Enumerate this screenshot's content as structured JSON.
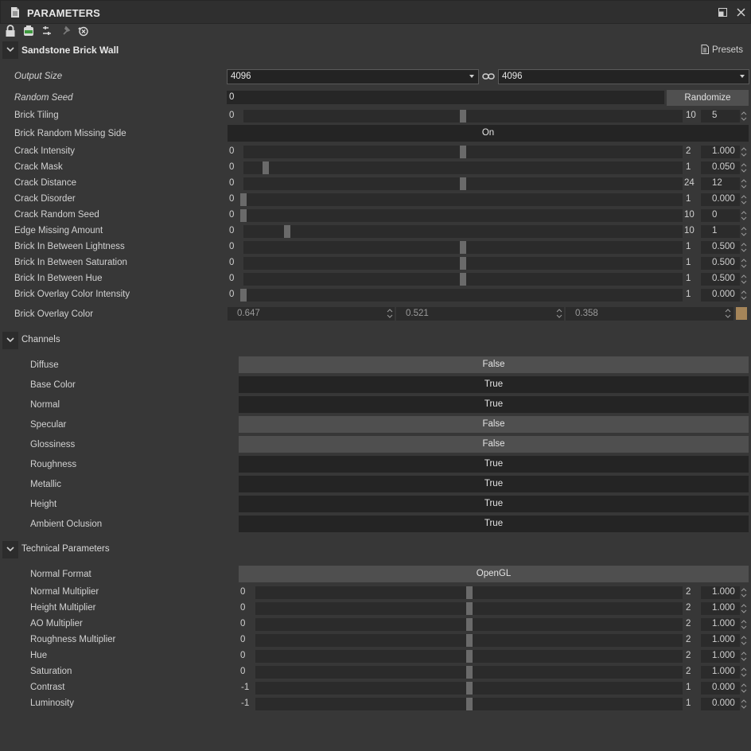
{
  "window": {
    "title": "PARAMETERS"
  },
  "toolbar": {
    "icons": [
      "lock-icon",
      "visibility-icon",
      "connect-icon",
      "pin-icon",
      "reset-icon"
    ]
  },
  "graph": {
    "title": "Sandstone Brick Wall",
    "presets_label": "Presets",
    "output_size": {
      "label": "Output Size",
      "width": "4096",
      "height": "4096"
    },
    "random_seed": {
      "label": "Random Seed",
      "value": "0",
      "button": "Randomize"
    },
    "brick_tiling": {
      "label": "Brick Tiling",
      "min": "0",
      "max": "10",
      "value": "5",
      "fraction": 0.5
    },
    "brick_random_missing_side": {
      "label": "Brick Random Missing Side",
      "value": "On"
    },
    "sliders": [
      {
        "label": "Crack Intensity",
        "min": "0",
        "max": "2",
        "value": "1.000",
        "fraction": 0.5
      },
      {
        "label": "Crack Mask",
        "min": "0",
        "max": "1",
        "value": "0.050",
        "fraction": 0.05
      },
      {
        "label": "Crack Distance",
        "min": "0",
        "max": "24",
        "value": "12",
        "fraction": 0.5
      },
      {
        "label": "Crack Disorder",
        "min": "0",
        "max": "1",
        "value": "0.000",
        "fraction": 0
      },
      {
        "label": "Crack Random Seed",
        "min": "0",
        "max": "10",
        "value": "0",
        "fraction": 0
      },
      {
        "label": "Edge Missing Amount",
        "min": "0",
        "max": "10",
        "value": "1",
        "fraction": 0.1
      },
      {
        "label": "Brick In Between Lightness",
        "min": "0",
        "max": "1",
        "value": "0.500",
        "fraction": 0.5
      },
      {
        "label": "Brick In Between Saturation",
        "min": "0",
        "max": "1",
        "value": "0.500",
        "fraction": 0.5
      },
      {
        "label": "Brick In Between Hue",
        "min": "0",
        "max": "1",
        "value": "0.500",
        "fraction": 0.5
      },
      {
        "label": "Brick Overlay Color Intensity",
        "min": "0",
        "max": "1",
        "value": "0.000",
        "fraction": 0
      }
    ],
    "overlay_color": {
      "label": "Brick Overlay Color",
      "r": "0.647",
      "g": "0.521",
      "b": "0.358",
      "swatch": "#a58559"
    }
  },
  "channels": {
    "title": "Channels",
    "items": [
      {
        "label": "Diffuse",
        "value": "False"
      },
      {
        "label": "Base Color",
        "value": "True"
      },
      {
        "label": "Normal",
        "value": "True"
      },
      {
        "label": "Specular",
        "value": "False"
      },
      {
        "label": "Glossiness",
        "value": "False"
      },
      {
        "label": "Roughness",
        "value": "True"
      },
      {
        "label": "Metallic",
        "value": "True"
      },
      {
        "label": "Height",
        "value": "True"
      },
      {
        "label": "Ambient Oclusion",
        "value": "True"
      }
    ]
  },
  "technical": {
    "title": "Technical Parameters",
    "normal_format": {
      "label": "Normal Format",
      "value": "OpenGL"
    },
    "sliders": [
      {
        "label": "Normal Multiplier",
        "min": "0",
        "max": "2",
        "value": "1.000",
        "fraction": 0.5
      },
      {
        "label": "Height Multiplier",
        "min": "0",
        "max": "2",
        "value": "1.000",
        "fraction": 0.5
      },
      {
        "label": "AO Multiplier",
        "min": "0",
        "max": "2",
        "value": "1.000",
        "fraction": 0.5
      },
      {
        "label": "Roughness Multiplier",
        "min": "0",
        "max": "2",
        "value": "1.000",
        "fraction": 0.5
      },
      {
        "label": "Hue",
        "min": "0",
        "max": "2",
        "value": "1.000",
        "fraction": 0.5
      },
      {
        "label": "Saturation",
        "min": "0",
        "max": "2",
        "value": "1.000",
        "fraction": 0.5
      },
      {
        "label": "Contrast",
        "min": "-1",
        "max": "1",
        "value": "0.000",
        "fraction": 0.5
      },
      {
        "label": "Luminosity",
        "min": "-1",
        "max": "1",
        "value": "0.000",
        "fraction": 0.5
      }
    ]
  },
  "colors": {
    "panel_bg": "#373737",
    "field_bg": "#2b2b2b",
    "thumb": "#6a6a6a",
    "toggle_on": "#242424",
    "toggle_off": "#4f4f4f"
  }
}
